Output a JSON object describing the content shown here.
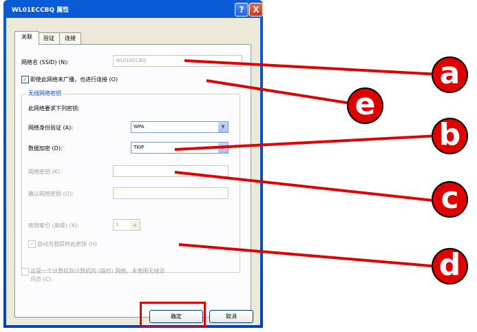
{
  "window": {
    "title": "WL01ECCBQ 属性",
    "help_glyph": "?",
    "close_glyph": "X"
  },
  "tabs": [
    "关联",
    "验证",
    "连接"
  ],
  "ssid": {
    "label": "网络名 (SSID) (N):",
    "value": "WL01ECCBQ"
  },
  "broadcast": {
    "label": "即使此网络未广播，也进行连接 (O)",
    "checked": true
  },
  "group": {
    "title": "无线网络密钥",
    "subtitle": "此网络要求下列密钥:",
    "auth_label": "网络身份验证 (A):",
    "auth_value": "WPA",
    "enc_label": "数据加密 (D):",
    "enc_value": "TKIP",
    "key_label": "网络密钥 (K):",
    "confirm_label": "确认网络密钥 (O):",
    "index_label": "密钥索引 (高级) (X):",
    "index_value": "1",
    "auto_label": "自动为我提供此密钥 (H)"
  },
  "adhoc": {
    "label_line1": "这是一个计算机到计算机的 (临时) 网络，未使用无线访",
    "label_line2": "问点 (C)"
  },
  "buttons": {
    "ok": "确定",
    "cancel": "取消"
  },
  "callouts": [
    "a",
    "e",
    "b",
    "c",
    "d"
  ],
  "colors": {
    "callout_red": "#e00000",
    "accent_blue": "#0a5bd6"
  }
}
